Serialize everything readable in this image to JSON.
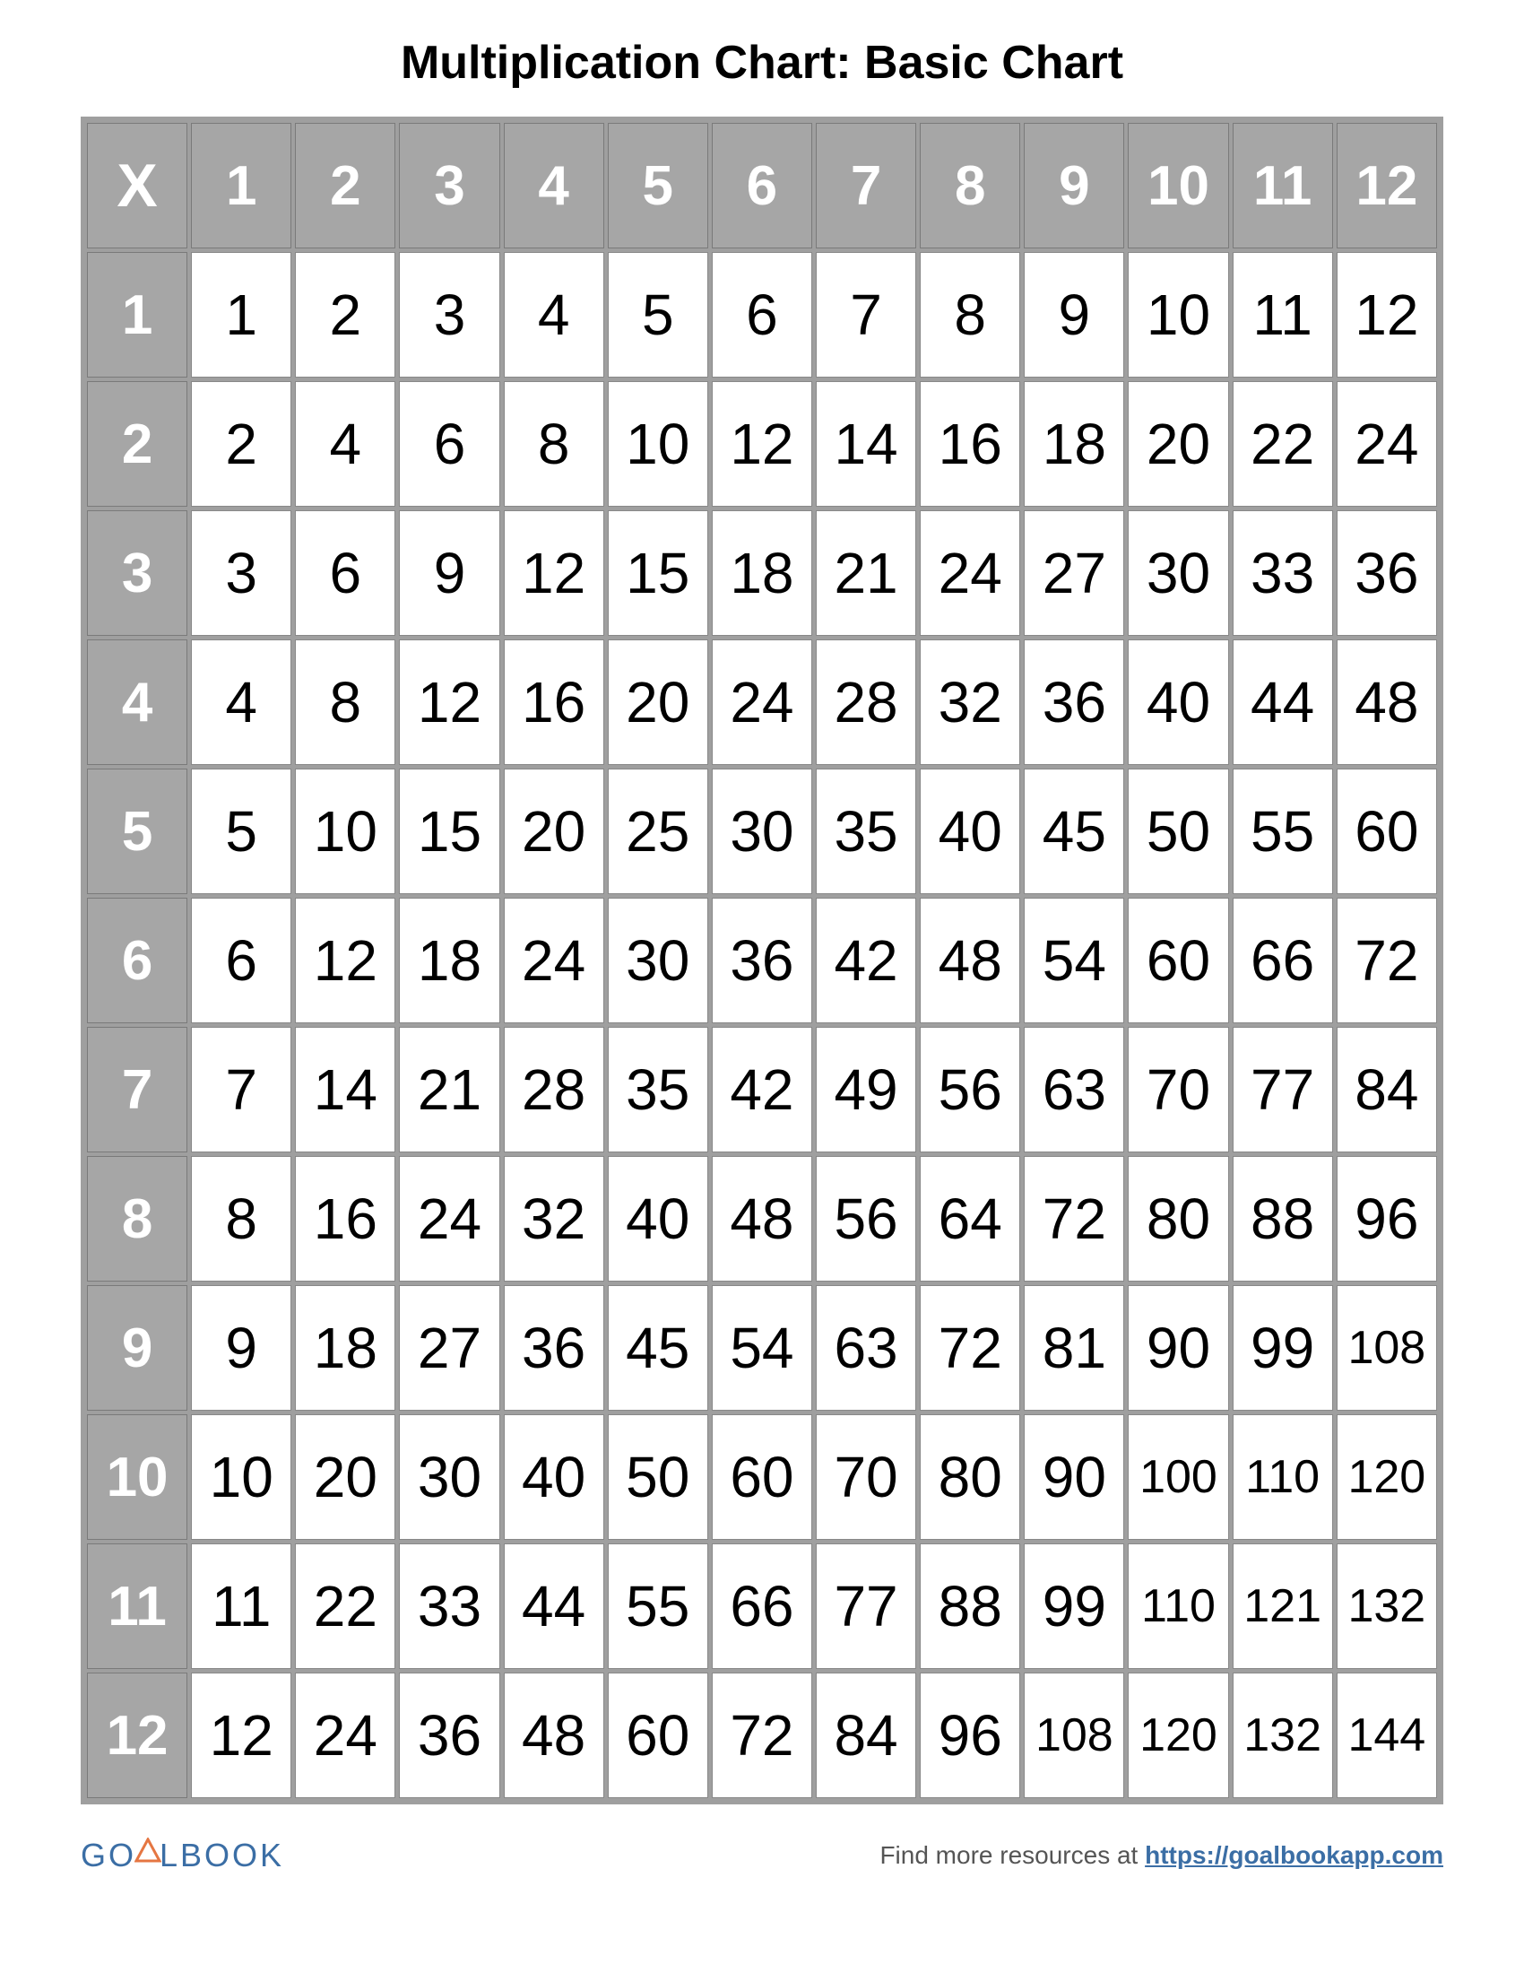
{
  "title": "Multiplication Chart: Basic Chart",
  "corner_label": "X",
  "col_headers": [
    "1",
    "2",
    "3",
    "4",
    "5",
    "6",
    "7",
    "8",
    "9",
    "10",
    "11",
    "12"
  ],
  "row_headers": [
    "1",
    "2",
    "3",
    "4",
    "5",
    "6",
    "7",
    "8",
    "9",
    "10",
    "11",
    "12"
  ],
  "rows": [
    [
      "1",
      "2",
      "3",
      "4",
      "5",
      "6",
      "7",
      "8",
      "9",
      "10",
      "11",
      "12"
    ],
    [
      "2",
      "4",
      "6",
      "8",
      "10",
      "12",
      "14",
      "16",
      "18",
      "20",
      "22",
      "24"
    ],
    [
      "3",
      "6",
      "9",
      "12",
      "15",
      "18",
      "21",
      "24",
      "27",
      "30",
      "33",
      "36"
    ],
    [
      "4",
      "8",
      "12",
      "16",
      "20",
      "24",
      "28",
      "32",
      "36",
      "40",
      "44",
      "48"
    ],
    [
      "5",
      "10",
      "15",
      "20",
      "25",
      "30",
      "35",
      "40",
      "45",
      "50",
      "55",
      "60"
    ],
    [
      "6",
      "12",
      "18",
      "24",
      "30",
      "36",
      "42",
      "48",
      "54",
      "60",
      "66",
      "72"
    ],
    [
      "7",
      "14",
      "21",
      "28",
      "35",
      "42",
      "49",
      "56",
      "63",
      "70",
      "77",
      "84"
    ],
    [
      "8",
      "16",
      "24",
      "32",
      "40",
      "48",
      "56",
      "64",
      "72",
      "80",
      "88",
      "96"
    ],
    [
      "9",
      "18",
      "27",
      "36",
      "45",
      "54",
      "63",
      "72",
      "81",
      "90",
      "99",
      "108"
    ],
    [
      "10",
      "20",
      "30",
      "40",
      "50",
      "60",
      "70",
      "80",
      "90",
      "100",
      "110",
      "120"
    ],
    [
      "11",
      "22",
      "33",
      "44",
      "55",
      "66",
      "77",
      "88",
      "99",
      "110",
      "121",
      "132"
    ],
    [
      "12",
      "24",
      "36",
      "48",
      "60",
      "72",
      "84",
      "96",
      "108",
      "120",
      "132",
      "144"
    ]
  ],
  "footer": {
    "logo_left": "GO",
    "logo_right": "LBOOK",
    "resources_text": "Find more resources at ",
    "resources_link": "https://goalbookapp.com"
  },
  "chart_data": {
    "type": "table",
    "title": "Multiplication Chart: Basic Chart",
    "col_headers": [
      1,
      2,
      3,
      4,
      5,
      6,
      7,
      8,
      9,
      10,
      11,
      12
    ],
    "row_headers": [
      1,
      2,
      3,
      4,
      5,
      6,
      7,
      8,
      9,
      10,
      11,
      12
    ],
    "values": [
      [
        1,
        2,
        3,
        4,
        5,
        6,
        7,
        8,
        9,
        10,
        11,
        12
      ],
      [
        2,
        4,
        6,
        8,
        10,
        12,
        14,
        16,
        18,
        20,
        22,
        24
      ],
      [
        3,
        6,
        9,
        12,
        15,
        18,
        21,
        24,
        27,
        30,
        33,
        36
      ],
      [
        4,
        8,
        12,
        16,
        20,
        24,
        28,
        32,
        36,
        40,
        44,
        48
      ],
      [
        5,
        10,
        15,
        20,
        25,
        30,
        35,
        40,
        45,
        50,
        55,
        60
      ],
      [
        6,
        12,
        18,
        24,
        30,
        36,
        42,
        48,
        54,
        60,
        66,
        72
      ],
      [
        7,
        14,
        21,
        28,
        35,
        42,
        49,
        56,
        63,
        70,
        77,
        84
      ],
      [
        8,
        16,
        24,
        32,
        40,
        48,
        56,
        64,
        72,
        80,
        88,
        96
      ],
      [
        9,
        18,
        27,
        36,
        45,
        54,
        63,
        72,
        81,
        90,
        99,
        108
      ],
      [
        10,
        20,
        30,
        40,
        50,
        60,
        70,
        80,
        90,
        100,
        110,
        120
      ],
      [
        11,
        22,
        33,
        44,
        55,
        66,
        77,
        88,
        99,
        110,
        121,
        132
      ],
      [
        12,
        24,
        36,
        48,
        60,
        72,
        84,
        96,
        108,
        120,
        132,
        144
      ]
    ]
  }
}
